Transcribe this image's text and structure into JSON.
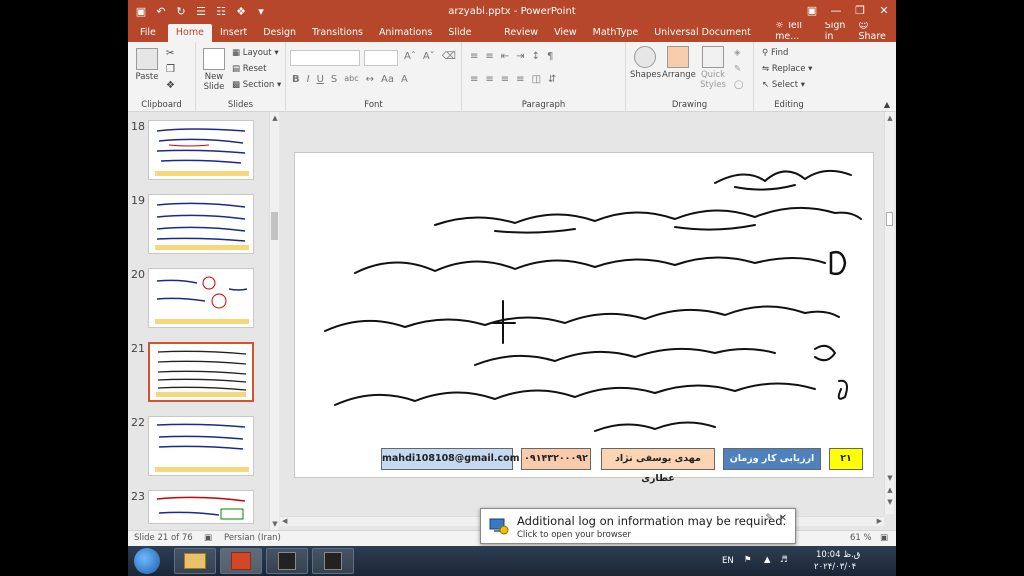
{
  "window": {
    "title": "arzyabi.pptx - PowerPoint"
  },
  "tabs": [
    {
      "label": "File"
    },
    {
      "label": "Home"
    },
    {
      "label": "Insert"
    },
    {
      "label": "Design"
    },
    {
      "label": "Transitions"
    },
    {
      "label": "Animations"
    },
    {
      "label": "Slide Show"
    },
    {
      "label": "Review"
    },
    {
      "label": "View"
    },
    {
      "label": "MathType"
    },
    {
      "label": "Universal Document Converter"
    }
  ],
  "tabs_right": {
    "tell_me": "Tell me...",
    "sign_in": "Sign in",
    "share": "Share"
  },
  "ribbon": {
    "clipboard": {
      "label": "Clipboard",
      "paste": "Paste"
    },
    "slides": {
      "label": "Slides",
      "new_slide": "New Slide",
      "layout": "Layout",
      "reset": "Reset",
      "section": "Section"
    },
    "font": {
      "label": "Font",
      "bold": "B",
      "italic": "I",
      "underline": "U",
      "strike": "S",
      "abc": "abc"
    },
    "paragraph": {
      "label": "Paragraph"
    },
    "drawing": {
      "label": "Drawing",
      "shapes": "Shapes",
      "arrange": "Arrange",
      "quick_styles": "Quick Styles"
    },
    "editing": {
      "label": "Editing",
      "find": "Find",
      "replace": "Replace",
      "select": "Select"
    }
  },
  "thumbnails": [
    {
      "num": "18"
    },
    {
      "num": "19"
    },
    {
      "num": "20"
    },
    {
      "num": "21"
    },
    {
      "num": "22"
    },
    {
      "num": "23"
    }
  ],
  "slide_footer": {
    "email": "mahdi108108@gmail.com",
    "phone": "۰۹۱۴۳۲۰۰۰۹۲",
    "author": "مهدی یوسفی نژاد عطاری",
    "topic": "ارزیابی کار وزمان",
    "page": "۲۱"
  },
  "colors": {
    "accent": "#b7472a",
    "email_box": "#c5d9f1",
    "phone_box": "#f8cbad",
    "author_box": "#fbd4b4",
    "topic_box": "#4f81bd",
    "page_box": "#ffff00"
  },
  "status": {
    "slide_info": "Slide 21 of 76",
    "language": "Persian (Iran)",
    "zoom": "61 %"
  },
  "notification": {
    "title": "Additional log on information may be required.",
    "subtitle": "Click to open your browser"
  },
  "tray": {
    "lang": "EN",
    "time": "10:04 ق.ظ",
    "date": "۲۰۲۴/۰۳/۰۴"
  }
}
